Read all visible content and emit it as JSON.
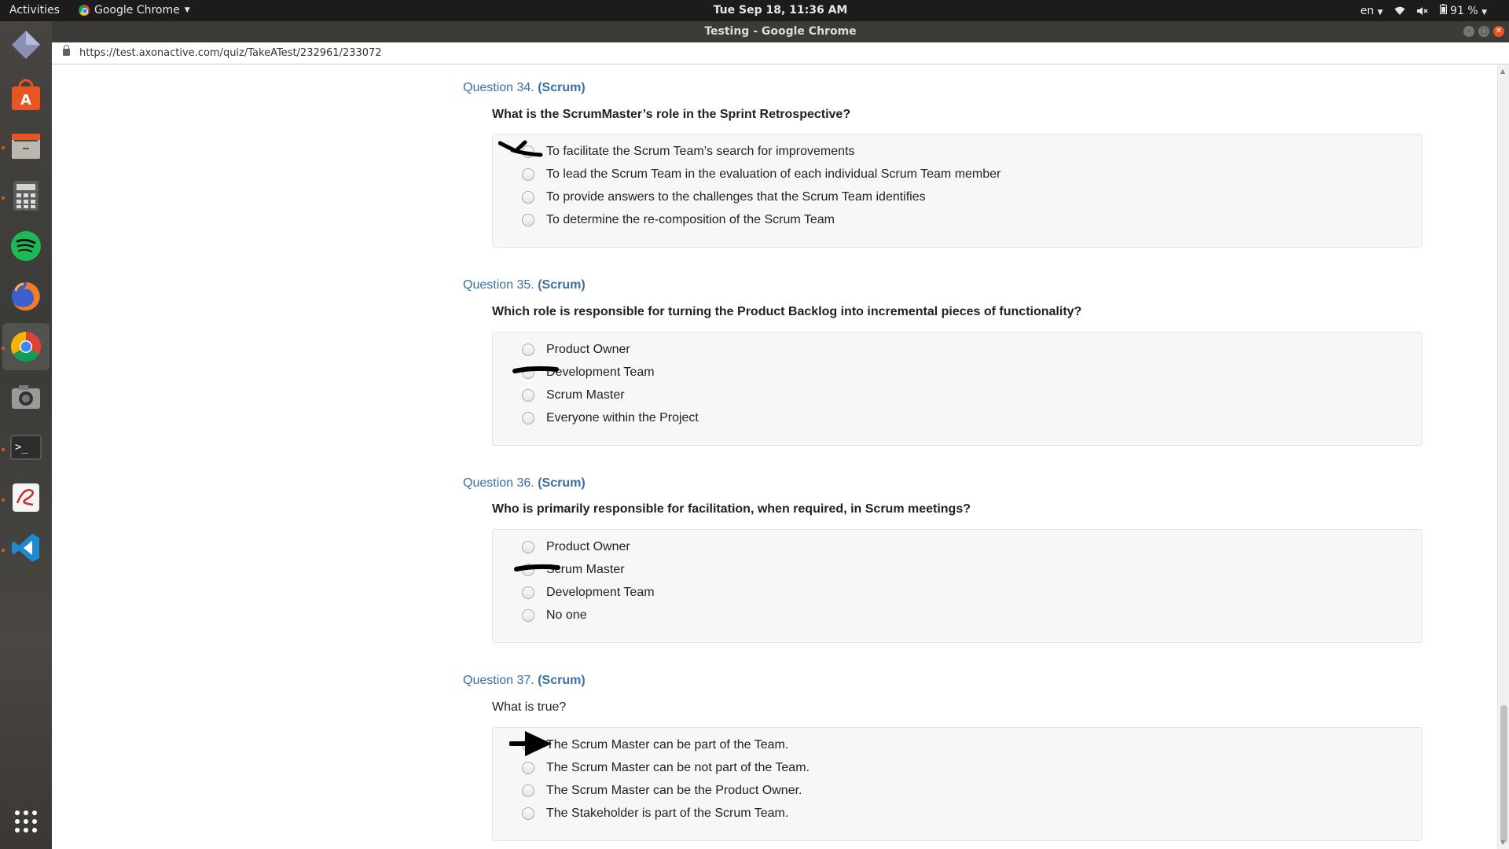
{
  "topbar": {
    "activities": "Activities",
    "app_name": "Google Chrome",
    "clock": "Tue Sep 18, 11:36 AM",
    "language": "en",
    "battery": "91 %"
  },
  "window": {
    "title": "Testing - Google Chrome",
    "url": "https://test.axonactive.com/quiz/TakeATest/232961/233072"
  },
  "dock": {
    "items": [
      "diamond-app-icon",
      "software-center-icon",
      "files-icon",
      "calculator-icon",
      "spotify-icon",
      "firefox-icon",
      "chrome-icon",
      "camera-icon",
      "terminal-icon",
      "evince-icon",
      "vscode-icon",
      "show-apps-icon"
    ]
  },
  "questions": [
    {
      "number": "Question 34.",
      "category": "(Scrum)",
      "text": "What is the ScrumMaster’s role in the Sprint Retrospective?",
      "options": [
        "To facilitate the Scrum Team’s search for improvements",
        "To lead the Scrum Team in the evaluation of each individual Scrum Team member",
        "To provide answers to the challenges that the Scrum Team identifies",
        "To determine the re-composition of the Scrum Team"
      ]
    },
    {
      "number": "Question 35.",
      "category": "(Scrum)",
      "text": "Which role is responsible for turning the Product Backlog into incremental pieces of functionality?",
      "options": [
        "Product Owner",
        "Development Team",
        "Scrum Master",
        "Everyone within the Project"
      ]
    },
    {
      "number": "Question 36.",
      "category": "(Scrum)",
      "text": "Who is primarily responsible for facilitation, when required, in Scrum meetings?",
      "options": [
        "Product Owner",
        "Scrum Master",
        "Development Team",
        "No one"
      ]
    },
    {
      "number": "Question 37.",
      "category": "(Scrum)",
      "text": "What is true?",
      "options": [
        "The Scrum Master can be part of the Team.",
        "The Scrum Master can be not part of the Team.",
        "The Scrum Master can be the Product Owner.",
        "The Stakeholder is part of the Scrum Team."
      ]
    }
  ],
  "colors": {
    "question_link": "#3a6ea5",
    "ubuntu_orange": "#e95420",
    "scribble": "#000000"
  }
}
